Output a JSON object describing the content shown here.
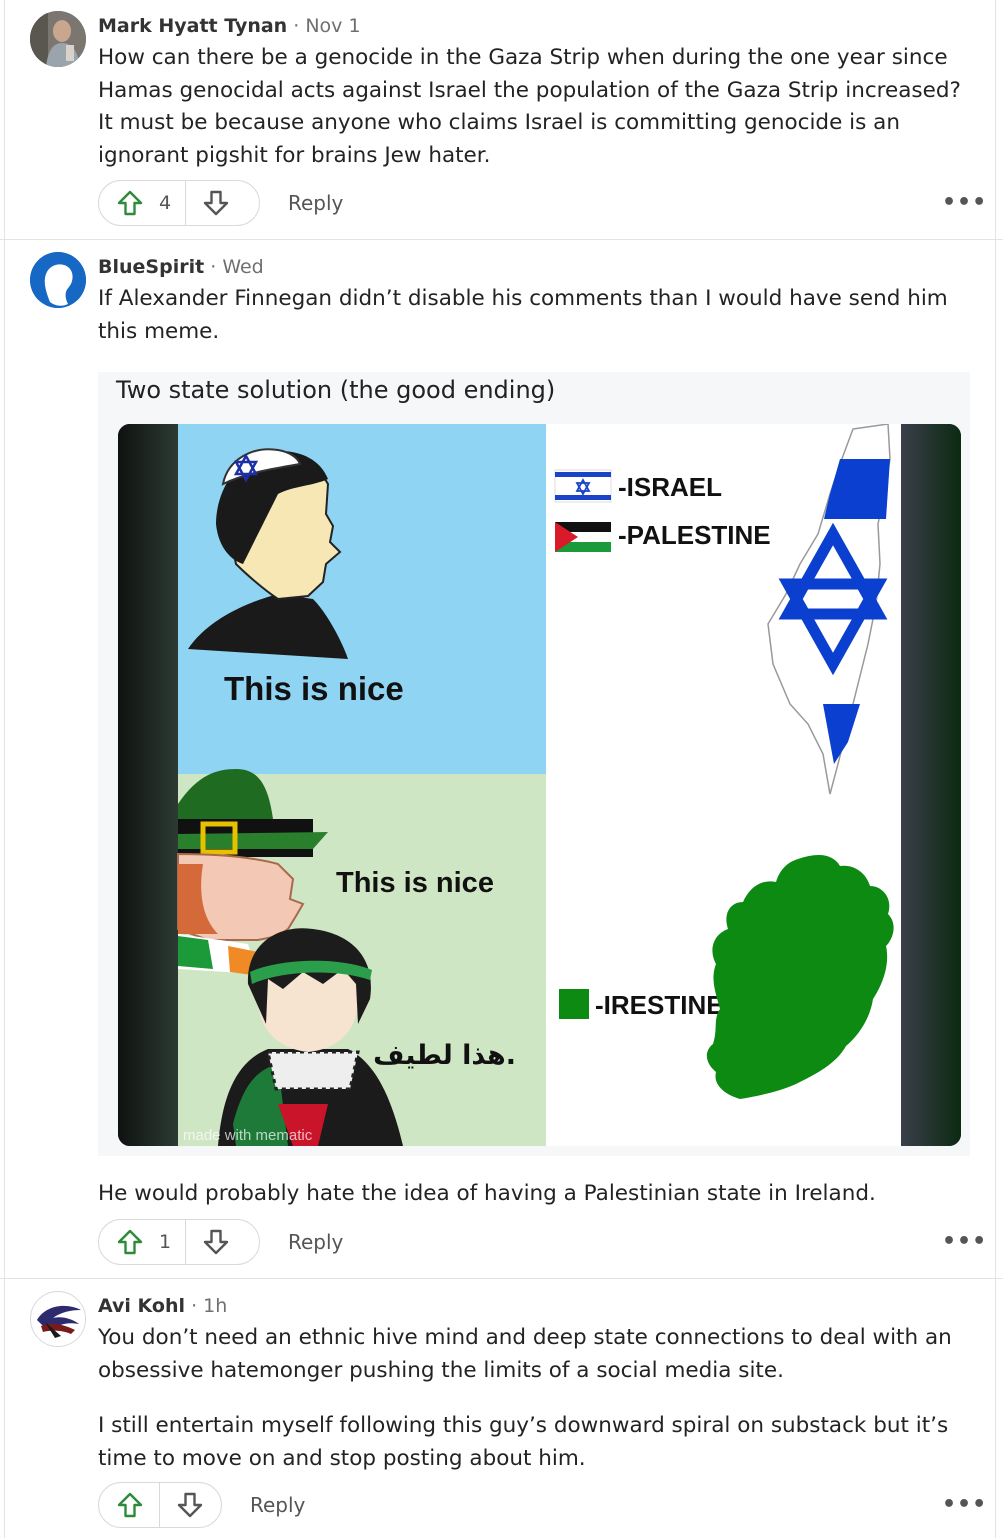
{
  "comments": [
    {
      "author": "Mark Hyatt Tynan",
      "separator": "·",
      "time": "Nov 1",
      "text": "How can there be a genocide in the Gaza Strip when during the one year since Hamas genocidal acts against Israel the population of the Gaza Strip increased? It must be because anyone who claims Israel is committing genocide is an ignorant pigshit for brains Jew hater.",
      "upvotes": "4",
      "reply_label": "Reply",
      "more_label": "•••"
    },
    {
      "author": "BlueSpirit",
      "separator": "·",
      "time": "Wed",
      "text": "If Alexander Finnegan didn’t disable his comments than I would have send him this meme.",
      "meme": {
        "title": "Two state solution (the good ending)",
        "panel_top_caption": "This is nice",
        "panel_bottom_caption": "This is nice",
        "panel_bottom_arabic": "هذا لطيف.",
        "legend_israel": "-ISRAEL",
        "legend_palestine": "-PALESTINE",
        "legend_irestine": "-IRESTINE",
        "watermark": "made with mematic"
      },
      "text_after": "He would probably hate the idea of having a Palestinian state in Ireland.",
      "upvotes": "1",
      "reply_label": "Reply",
      "more_label": "•••"
    },
    {
      "author": "Avi Kohl",
      "separator": "·",
      "time": "1h",
      "text": "You don’t need an ethnic hive mind and deep state connections to deal with an obsessive hatemonger pushing the limits of a social media site.",
      "text2": "I still entertain myself following this guy’s downward spiral on substack but it’s time to move on and stop posting about him.",
      "upvotes": "",
      "reply_label": "Reply",
      "more_label": "•••"
    }
  ],
  "colors": {
    "upvote_green": "#2e8b3a",
    "downvote_gray": "#555555",
    "israel_blue": "#0b3fcf",
    "ireland_green": "#0c8a12"
  }
}
